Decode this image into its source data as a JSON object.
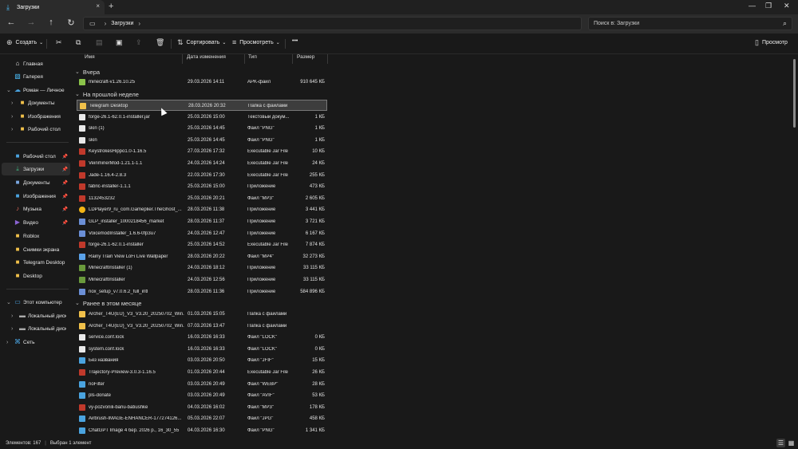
{
  "window": {
    "tab_title": "Загрузки",
    "new_tab": "+",
    "close_tab": "×",
    "minimize": "—",
    "maximize": "❐",
    "close": "✕"
  },
  "address": {
    "crumbs": [
      "Загрузки"
    ],
    "search_placeholder": "Поиск в: Загрузки"
  },
  "toolbar": {
    "create_label": "Создать",
    "sort_label": "Сортировать",
    "view_label": "Просмотреть",
    "more_label": "•••",
    "preview_label": "Просмотр"
  },
  "sidebar": {
    "items": [
      {
        "label": "Главная",
        "icon": "home-icon"
      },
      {
        "label": "Галерея",
        "icon": "gallery-icon"
      },
      {
        "label": "Роман — Личное",
        "icon": "cloud-icon"
      },
      {
        "label": "Документы",
        "icon": "folder-icon"
      },
      {
        "label": "Изображения",
        "icon": "folder-icon"
      },
      {
        "label": "Рабочий стол",
        "icon": "folder-icon"
      },
      {
        "label": "Рабочий стол",
        "icon": "desktop-icon"
      },
      {
        "label": "Загрузки",
        "icon": "download-icon"
      },
      {
        "label": "Документы",
        "icon": "documents-icon"
      },
      {
        "label": "Изображения",
        "icon": "pictures-icon"
      },
      {
        "label": "Музыка",
        "icon": "music-icon"
      },
      {
        "label": "Видео",
        "icon": "video-icon"
      },
      {
        "label": "Roblox",
        "icon": "folder-icon"
      },
      {
        "label": "Снимки экрана",
        "icon": "folder-icon"
      },
      {
        "label": "Telegram Desktop",
        "icon": "folder-icon"
      },
      {
        "label": "Desktop",
        "icon": "folder-icon"
      },
      {
        "label": "Этот компьютер",
        "icon": "pc-icon"
      },
      {
        "label": "Локальный диск (C:)",
        "icon": "drive-icon"
      },
      {
        "label": "Локальный диск (D:)",
        "icon": "drive-icon"
      },
      {
        "label": "Сеть",
        "icon": "network-icon"
      }
    ]
  },
  "columns": {
    "name": "Имя",
    "date": "Дата изменения",
    "type": "Тип",
    "size": "Размер"
  },
  "groups": [
    {
      "label": "Вчера"
    },
    {
      "label": "На прошлой неделе"
    },
    {
      "label": "Ранее в этом месяце"
    }
  ],
  "files": [
    {
      "name": "minecraft-v1.26.10.25",
      "date": "29.03.2026 14:11",
      "type": "APK-файл",
      "size": "910 645 КБ",
      "icon": "apk"
    },
    {
      "name": "Telegram Desktop",
      "date": "28.03.2026 20:32",
      "type": "Папка с файлами",
      "size": "",
      "icon": "folder"
    },
    {
      "name": "forge-26.1-62.0.1-installer.jar",
      "date": "25.03.2026 15:00",
      "type": "Текстовый докум...",
      "size": "1 КБ",
      "icon": "doc"
    },
    {
      "name": "skin (1)",
      "date": "25.03.2026 14:45",
      "type": "Файл \"PNG\"",
      "size": "1 КБ",
      "icon": "doc"
    },
    {
      "name": "skin",
      "date": "25.03.2026 14:45",
      "type": "Файл \"PNG\"",
      "size": "1 КБ",
      "icon": "doc"
    },
    {
      "name": "KeystrokesHippo1.0-1.16.5",
      "date": "27.03.2026 17:32",
      "type": "Executable Jar File",
      "size": "10 КБ",
      "icon": "jar"
    },
    {
      "name": "VeinminerMod-1.21.1-1.1",
      "date": "24.03.2026 14:24",
      "type": "Executable Jar File",
      "size": "24 КБ",
      "icon": "jar"
    },
    {
      "name": "Jade-1.16.4-2.8.3",
      "date": "22.03.2026 17:30",
      "type": "Executable Jar File",
      "size": "255 КБ",
      "icon": "jar"
    },
    {
      "name": "fabric-installer-1.1.1",
      "date": "25.03.2026 15:00",
      "type": "Приложение",
      "size": "473 КБ",
      "icon": "jar"
    },
    {
      "name": "1132453232",
      "date": "25.03.2026 20:21",
      "type": "Файл \"MP3\"",
      "size": "2 605 КБ",
      "icon": "jar"
    },
    {
      "name": "LDPlayer9_ru_com.Gameplier.TheGhost_...",
      "date": "28.03.2026 11:38",
      "type": "Приложение",
      "size": "3 441 КБ",
      "icon": "ld"
    },
    {
      "name": "GLP_installer_1000218456_market",
      "date": "28.03.2026 11:37",
      "type": "Приложение",
      "size": "3 721 КБ",
      "icon": "app"
    },
    {
      "name": "VoicemodInstaller_1.6.6-0fp3u7",
      "date": "24.03.2026 12:47",
      "type": "Приложение",
      "size": "6 167 КБ",
      "icon": "app"
    },
    {
      "name": "forge-26.1-62.0.1-installer",
      "date": "25.03.2026 14:52",
      "type": "Executable Jar File",
      "size": "7 874 КБ",
      "icon": "jar"
    },
    {
      "name": "Rainy Train View LoFi Live Wallpaper",
      "date": "28.03.2026 20:22",
      "type": "Файл \"MP4\"",
      "size": "32 273 КБ",
      "icon": "media"
    },
    {
      "name": "MinecraftInstaller (1)",
      "date": "24.03.2026 18:12",
      "type": "Приложение",
      "size": "33 115 КБ",
      "icon": "mc"
    },
    {
      "name": "MinecraftInstaller",
      "date": "24.03.2026 12:56",
      "type": "Приложение",
      "size": "33 115 КБ",
      "icon": "mc"
    },
    {
      "name": "nox_setup_v7.0.6.2_full_intl",
      "date": "28.03.2026 11:36",
      "type": "Приложение",
      "size": "584 896 КБ",
      "icon": "app"
    },
    {
      "name": "Archer_T4U(EU)_V3_V3.20_20250702_Win...",
      "date": "01.03.2026 15:05",
      "type": "Папка с файлами",
      "size": "",
      "icon": "folder"
    },
    {
      "name": "Archer_T4U(EU)_V3_V3.20_20250702_Win...",
      "date": "07.03.2026 13:47",
      "type": "Папка с файлами",
      "size": "",
      "icon": "folder"
    },
    {
      "name": "service.conf.lock",
      "date": "16.03.2026 16:33",
      "type": "Файл \"LOCK\"",
      "size": "0 КБ",
      "icon": "doc"
    },
    {
      "name": "system.conf.lock",
      "date": "16.03.2026 16:33",
      "type": "Файл \"LOCK\"",
      "size": "0 КБ",
      "icon": "doc"
    },
    {
      "name": "Без названия",
      "date": "03.03.2026 20:50",
      "type": "Файл \"JFIF\"",
      "size": "15 КБ",
      "icon": "img"
    },
    {
      "name": "Trajectory-Preview-3.0.3-1.16.5",
      "date": "01.03.2026 20:44",
      "type": "Executable Jar File",
      "size": "26 КБ",
      "icon": "jar"
    },
    {
      "name": "noFilter",
      "date": "03.03.2026 20:49",
      "type": "Файл \"WEBP\"",
      "size": "28 КБ",
      "icon": "img"
    },
    {
      "name": "pls-donate",
      "date": "03.03.2026 20:49",
      "type": "Файл \"AVIF\"",
      "size": "53 КБ",
      "icon": "img"
    },
    {
      "name": "vy-pozvonili-bariu-batiushke",
      "date": "04.03.2026 16:02",
      "type": "Файл \"MP3\"",
      "size": "178 КБ",
      "icon": "jar"
    },
    {
      "name": "Airbrush-IMAGE-ENHANCER-177274126...",
      "date": "05.03.2026 22:07",
      "type": "Файл \"JPG\"",
      "size": "458 КБ",
      "icon": "img"
    },
    {
      "name": "ChatGPT Image 4 бер. 2026 р., 16_30_55",
      "date": "04.03.2026 16:30",
      "type": "Файл \"PNG\"",
      "size": "1 341 КБ",
      "icon": "img"
    }
  ],
  "status": {
    "count": "Элементов: 167",
    "selected": "Выбран 1 элемент"
  },
  "colors": {
    "accent": "#4cc2ff",
    "folder": "#f0c04a",
    "background": "#191919"
  }
}
